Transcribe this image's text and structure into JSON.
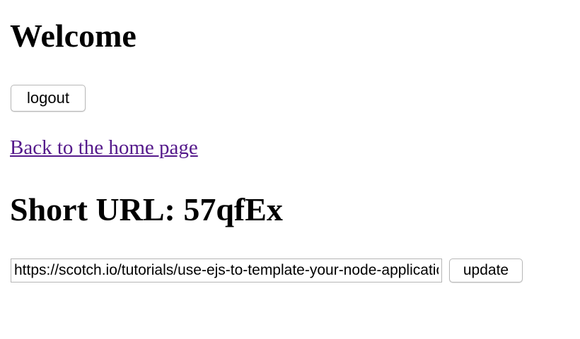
{
  "page": {
    "welcome_heading": "Welcome",
    "logout_label": "logout",
    "home_link_text": "Back to the home page",
    "short_url_heading": "Short URL: 57qfEx",
    "long_url_value": "https://scotch.io/tutorials/use-ejs-to-template-your-node-application",
    "update_label": "update"
  },
  "colors": {
    "link_visited": "#551a8b",
    "text": "#000000",
    "background": "#ffffff"
  }
}
